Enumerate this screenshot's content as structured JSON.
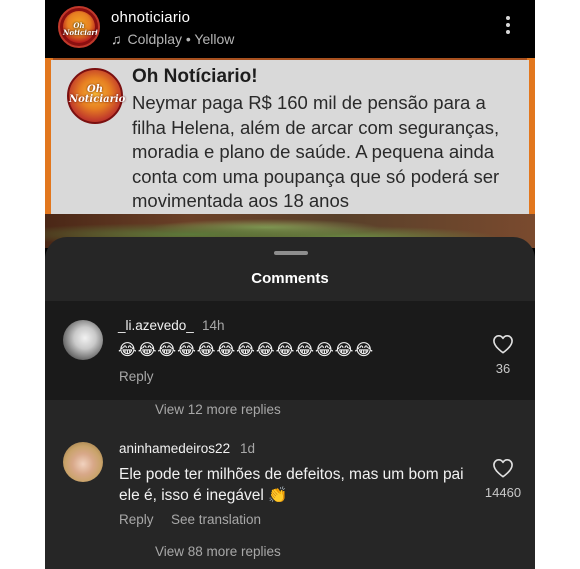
{
  "post": {
    "username": "ohnoticiario",
    "music": "Coldplay • Yellow",
    "logo_text": "Oh Noticiario"
  },
  "news": {
    "logo_text": "Oh Noticiario",
    "title": "Oh Notíciario!",
    "body": "Neymar paga R$ 160 mil de pensão para a filha Helena, além de arcar com seguranças, moradia e plano de saúde. A pequena ainda conta com uma poupança que só poderá ser movimentada aos 18 anos"
  },
  "sheet": {
    "title": "Comments"
  },
  "comments": [
    {
      "user": "_li.azevedo_",
      "time": "14h",
      "text": "😂😂😂😂😂😂😂😂😂😂😂😂😂",
      "reply": "Reply",
      "likes": "36",
      "view_more": "View 12 more replies"
    },
    {
      "user": "aninhamedeiros22",
      "time": "1d",
      "text": "Ele pode ter milhões de defeitos, mas um bom pai ele é, isso é inegável 👏",
      "reply": "Reply",
      "translate": "See translation",
      "likes": "14460",
      "view_more": "View 88 more replies"
    }
  ],
  "icons": {
    "music": "music-note-icon",
    "more": "more-vertical-icon",
    "like": "heart-outline-icon"
  },
  "colors": {
    "accent_orange": "#e2771e",
    "sheet_bg": "#262626",
    "highlight_bg": "#1a1a1a"
  }
}
